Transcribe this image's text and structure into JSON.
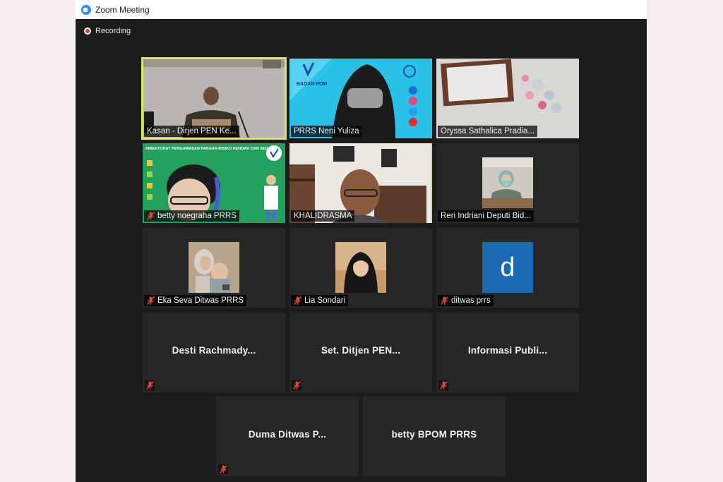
{
  "window": {
    "title": "Zoom Meeting"
  },
  "recording": {
    "label": "Recording"
  },
  "participants": [
    {
      "name": "Kasan - Dirjen PEN Ke...",
      "active_speaker": true,
      "video": true,
      "muted": false
    },
    {
      "name": "PRRS Neni Yuliza",
      "video": true,
      "muted": false,
      "background_text": "BADAN POM"
    },
    {
      "name": "Oryssa Sathalica Pradia...",
      "video": true,
      "muted": false
    },
    {
      "name": "betty noegraha PRRS",
      "video": true,
      "muted": true,
      "background_text": "DIREKTORAT PENGAWASAN PANGAN RISIKO RENDAH DAN SEDANG"
    },
    {
      "name": "KHALIDRASMA",
      "video": true,
      "muted": false
    },
    {
      "name": "Reri Indriani Deputi Bid...",
      "video": true,
      "muted": false
    },
    {
      "name": "Eka Seva Ditwas PRRS",
      "video": false,
      "muted": true
    },
    {
      "name": "Lia Sondari",
      "video": false,
      "muted": true
    },
    {
      "name": "ditwas prrs",
      "video": false,
      "muted": true,
      "avatar_letter": "d"
    },
    {
      "name": "Desti  Rachmady...",
      "video": false,
      "muted": true
    },
    {
      "name": "Set.  Ditjen  PEN...",
      "video": false,
      "muted": true
    },
    {
      "name": "Informasi  Publi...",
      "video": false,
      "muted": true
    },
    {
      "name": "Duma  Ditwas  P...",
      "video": false,
      "muted": true
    },
    {
      "name": "betty BPOM PRRS",
      "video": false,
      "muted": false
    }
  ],
  "colors": {
    "active_border": "#d6e85a",
    "tile_bg": "#262626",
    "window_bg": "#1c1c1c",
    "mute_red": "#e0463c",
    "avatar_blue": "#1a69b3"
  }
}
